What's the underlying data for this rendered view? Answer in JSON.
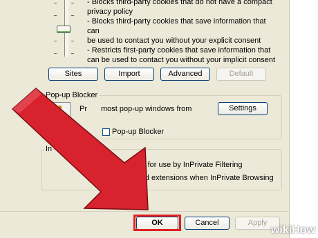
{
  "privacy": {
    "desc_lines": [
      "- Blocks third-party cookies that do not have a compact",
      "privacy policy",
      "- Blocks third-party cookies that save information that can",
      "be used to contact you without your explicit consent",
      "- Restricts first-party cookies that save information that",
      "can be used to contact you without your implicit consent"
    ],
    "buttons": {
      "sites": "Sites",
      "import": "Import",
      "advanced": "Advanced",
      "default": "Default"
    }
  },
  "popup_blocker": {
    "title": "Pop-up Blocker",
    "text_partial_1": "Pr",
    "text_partial_2": "most pop-up windows from",
    "checkbox_partial": "Pop-up Blocker",
    "settings": "Settings"
  },
  "inprivate": {
    "title_partial": "In",
    "line1_partial": "t data for use by InPrivate Filtering",
    "line2_partial": "s and extensions when InPrivate Browsing"
  },
  "dialog_buttons": {
    "ok": "OK",
    "cancel": "Cancel",
    "apply": "Apply"
  },
  "colors": {
    "dialog_bg": "#ece9d8",
    "arrow": "#d8232f",
    "highlight": "#e02020",
    "button_border": "#003c74"
  },
  "watermark": {
    "wiki": "wiki",
    "how": "How"
  }
}
